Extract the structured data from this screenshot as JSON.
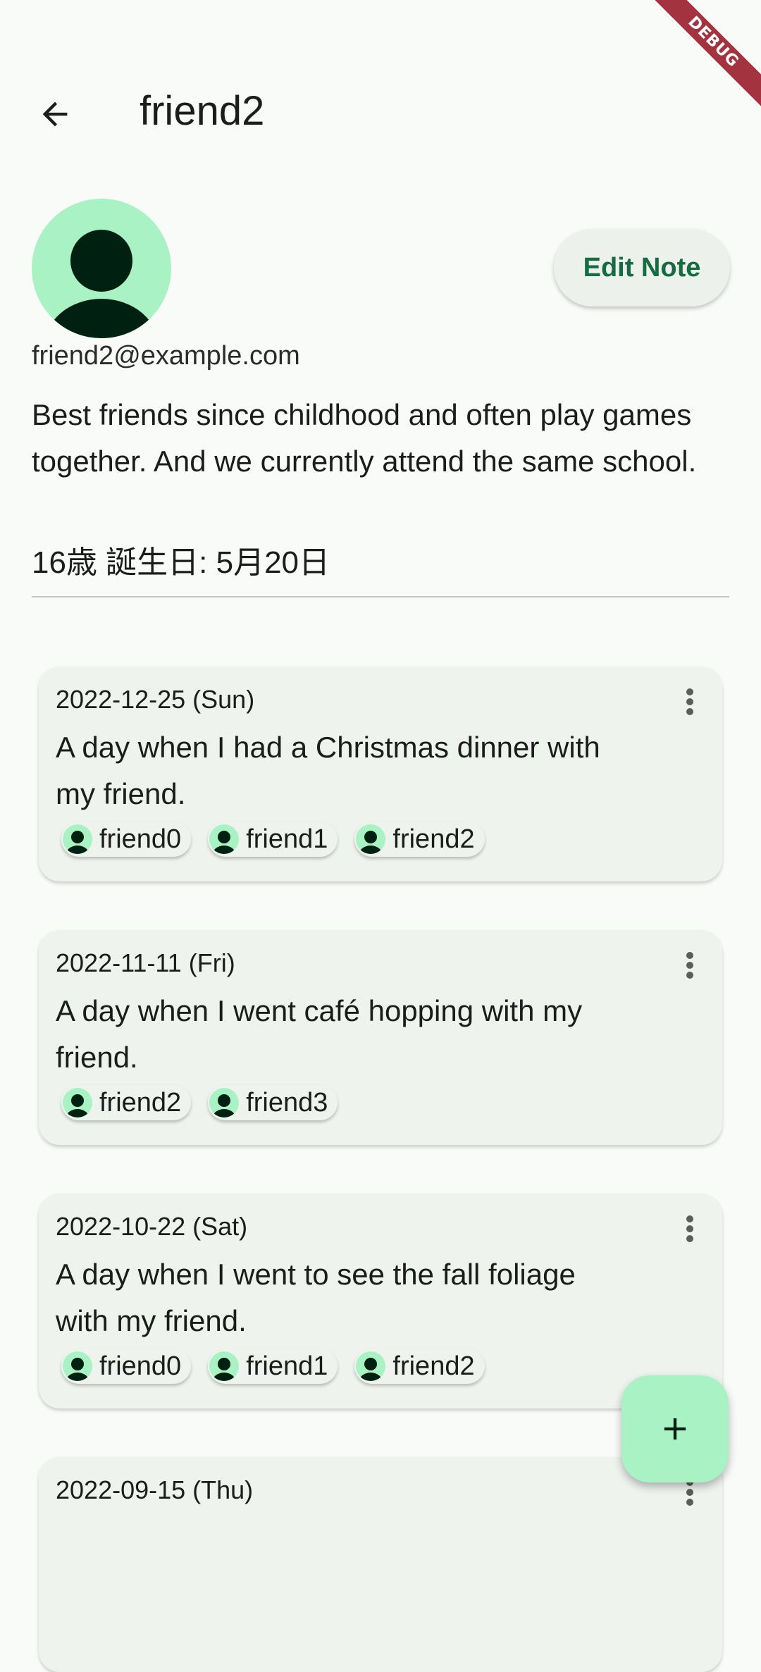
{
  "debug_banner": "DEBUG",
  "appbar": {
    "title": "friend2"
  },
  "profile": {
    "email": "friend2@example.com",
    "edit_button": "Edit Note",
    "note": "Best friends since childhood and often play games together. And we currently attend the same school.",
    "age_birthday": "16歳  誕生日: 5月20日"
  },
  "entries": [
    {
      "date": "2022-12-25 (Sun)",
      "text": "A day when I had a Christmas dinner with my friend.",
      "friends": [
        "friend0",
        "friend1",
        "friend2"
      ]
    },
    {
      "date": "2022-11-11 (Fri)",
      "text": "A day when I went café hopping with my friend.",
      "friends": [
        "friend2",
        "friend3"
      ]
    },
    {
      "date": "2022-10-22 (Sat)",
      "text": "A day when I went to see the fall foliage with my friend.",
      "friends": [
        "friend0",
        "friend1",
        "friend2"
      ]
    },
    {
      "date": "2022-09-15 (Thu)"
    }
  ],
  "icons": {
    "back": "arrow-back-icon",
    "more": "more-vert-icon",
    "add": "add-icon",
    "avatar": "person-icon"
  },
  "colors": {
    "accent": "#166b40",
    "avatar_bg": "#a8f2c4",
    "avatar_fg": "#002111",
    "card_bg": "#eef3ee",
    "debug": "#a3343f"
  }
}
